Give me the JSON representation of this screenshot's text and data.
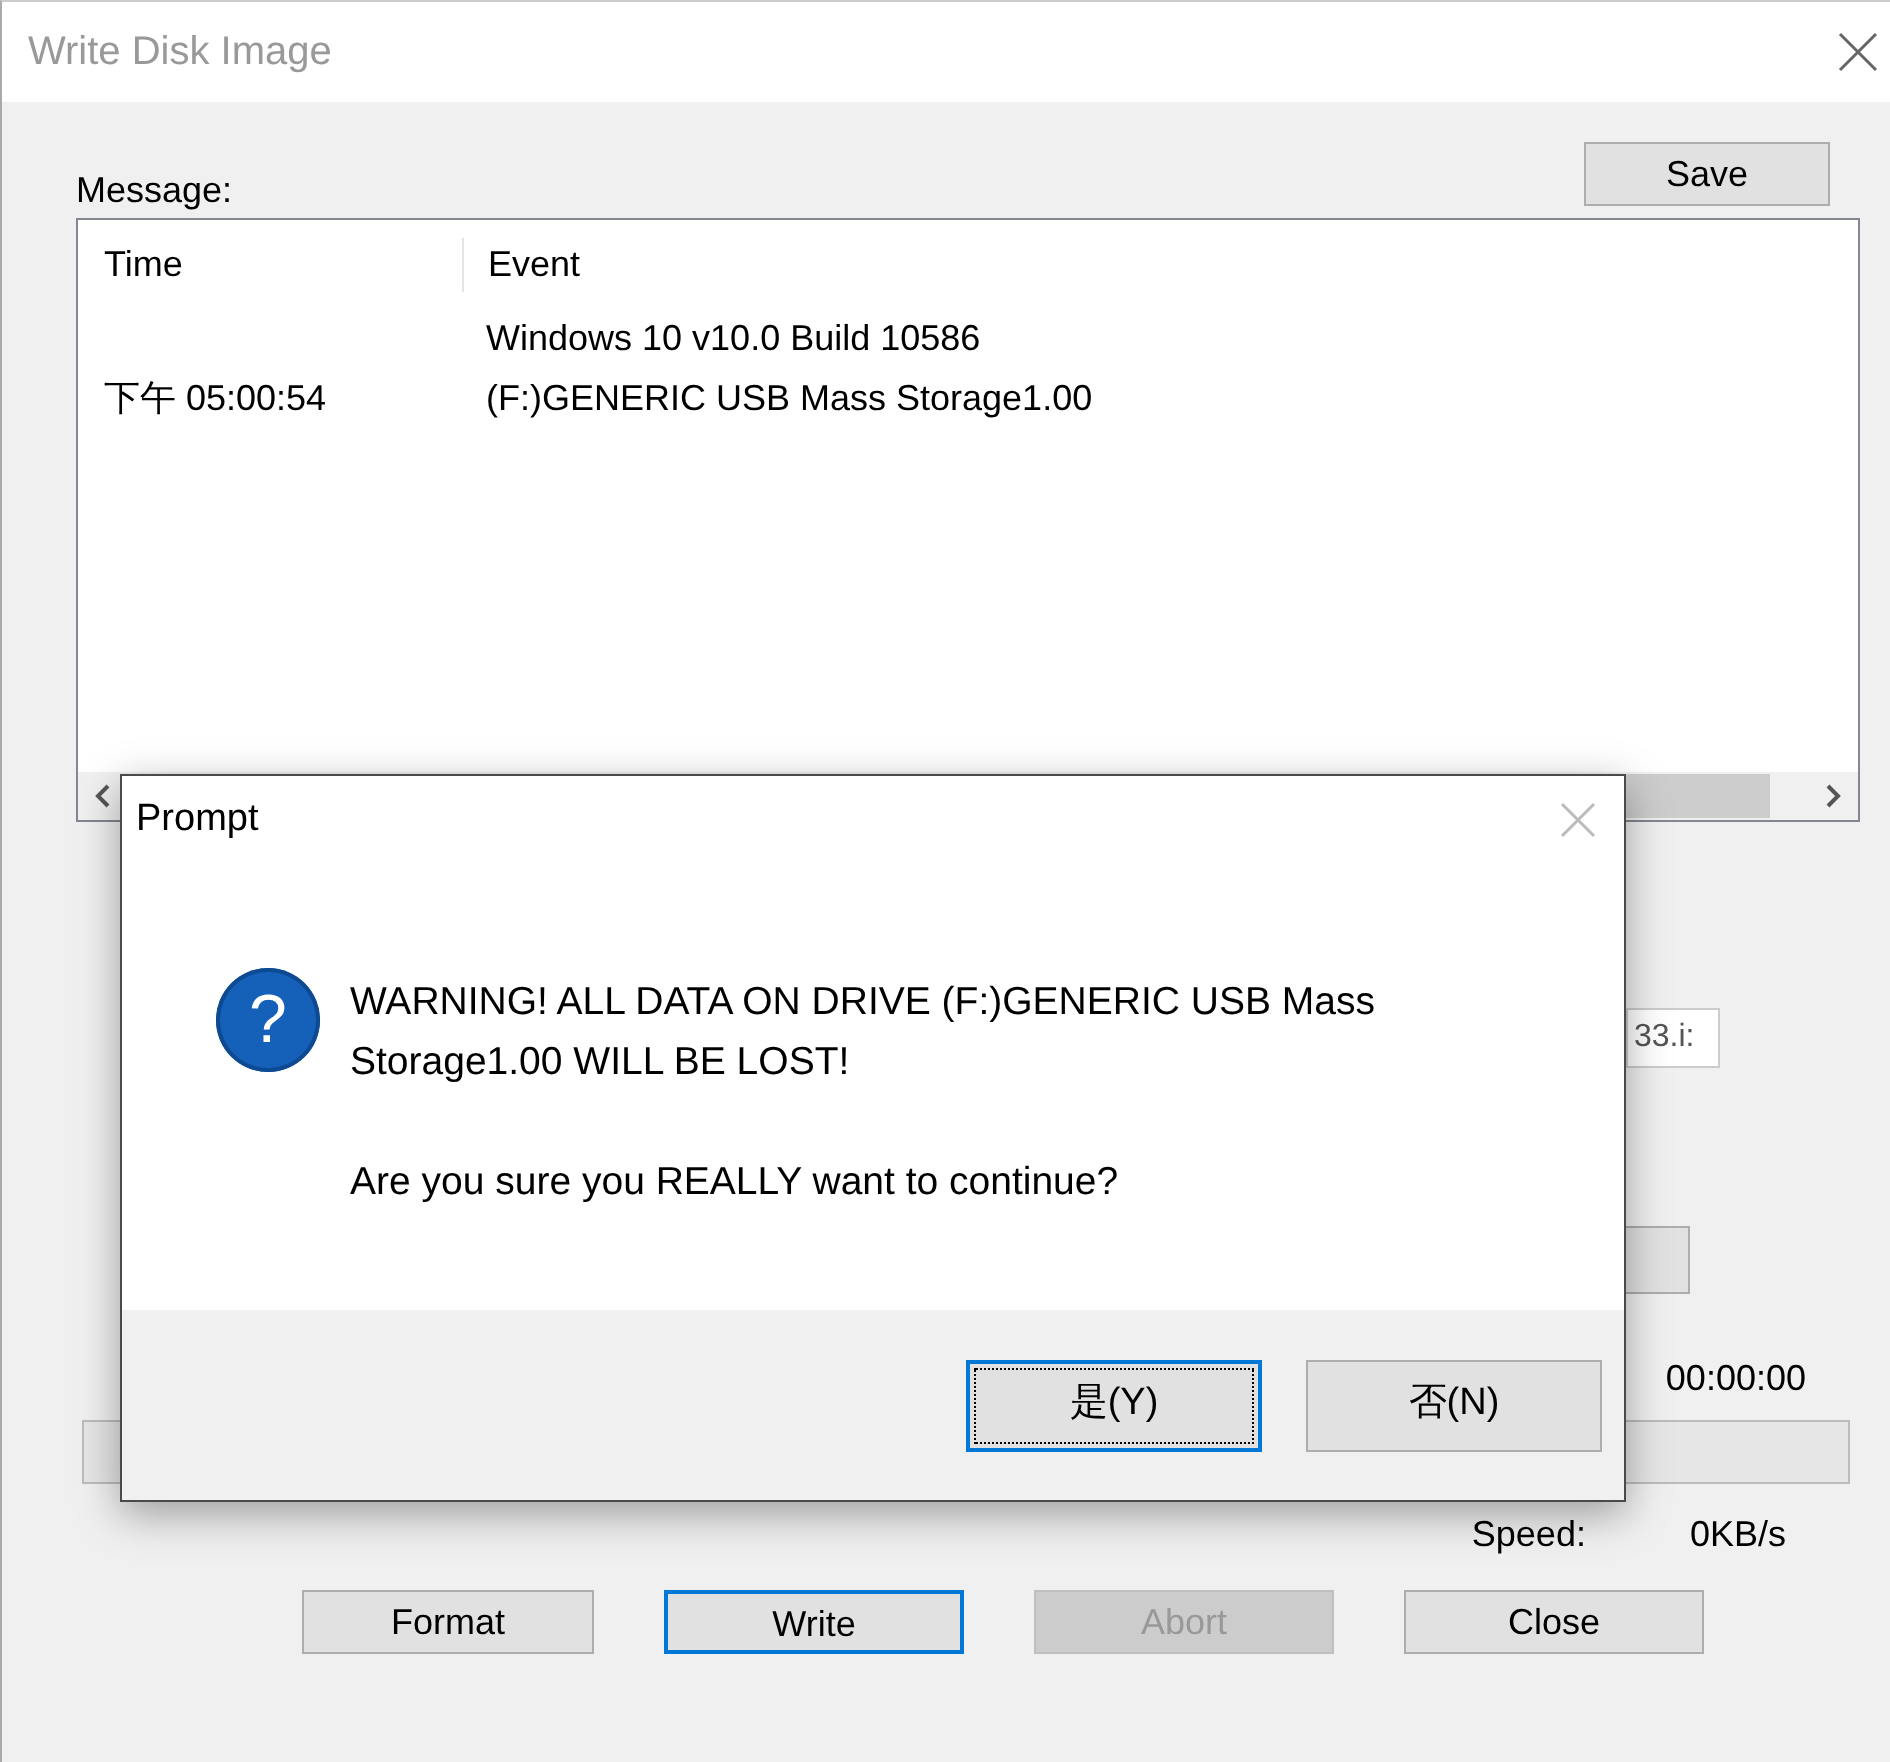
{
  "window": {
    "title": "Write Disk Image"
  },
  "message_label": "Message:",
  "save_button": "Save",
  "log": {
    "columns": [
      "Time",
      "Event"
    ],
    "rows": [
      {
        "event": "Windows 10 v10.0 Build 10586"
      },
      {
        "time": "下午 05:00:54",
        "event": "(F:)GENERIC USB Mass Storage1.00"
      }
    ]
  },
  "file_field": {
    "value": "33.i:"
  },
  "elapsed": "00:00:00",
  "progress": {
    "level": 0
  },
  "speed_label": "Speed:",
  "speed": "0KB/s",
  "buttons": [
    {
      "label": "Format",
      "default": false,
      "disabled": false
    },
    {
      "label": "Write",
      "default": true,
      "disabled": false
    },
    {
      "label": "Abort",
      "default": false,
      "disabled": true
    },
    {
      "label": "Close",
      "default": false,
      "disabled": false
    }
  ],
  "dialog": {
    "title": "Prompt",
    "icon": "?",
    "message": "WARNING! ALL DATA ON DRIVE (F:)GENERIC USB Mass Storage1.00 WILL BE LOST!",
    "question": "Are you sure you REALLY want to continue?",
    "buttons": [
      {
        "label": "是(Y)",
        "focused": true
      },
      {
        "label": "否(N)",
        "focused": false
      }
    ]
  }
}
